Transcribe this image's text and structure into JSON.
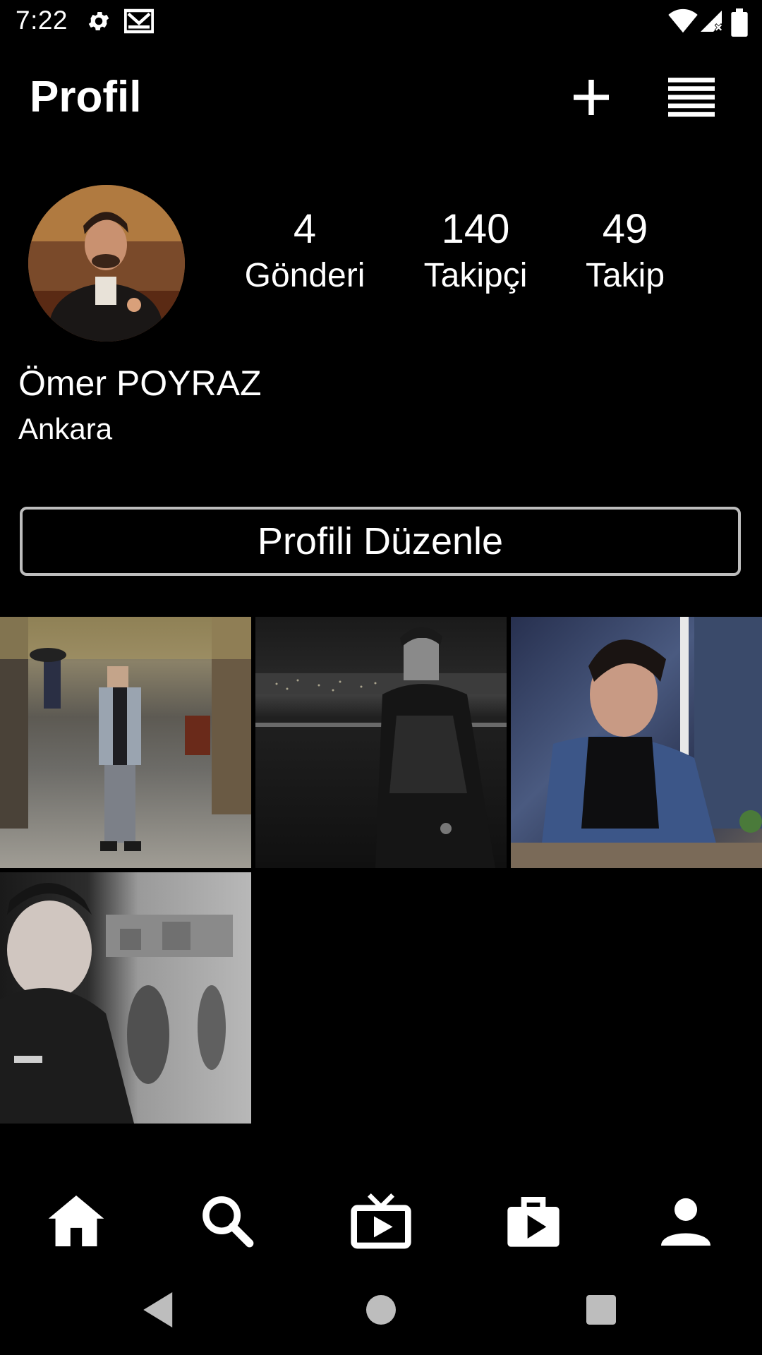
{
  "status_bar": {
    "time": "7:22"
  },
  "header": {
    "title": "Profil"
  },
  "profile": {
    "posts": {
      "count": "4",
      "label": "Gönderi"
    },
    "followers": {
      "count": "140",
      "label": "Takipçi"
    },
    "following": {
      "count": "49",
      "label": "Takip"
    },
    "name": "Ömer POYRAZ",
    "location": "Ankara",
    "edit_button": "Profili Düzenle"
  },
  "icons": {
    "status": [
      "gear-icon",
      "mail-icon",
      "wifi-icon",
      "signal-icon",
      "battery-icon"
    ],
    "header": [
      "plus-icon",
      "menu-icon"
    ],
    "bottom_nav": [
      "home-icon",
      "search-icon",
      "tv-icon",
      "shop-icon",
      "profile-icon"
    ],
    "system_nav": [
      "back-icon",
      "home-circle-icon",
      "recents-icon"
    ]
  },
  "posts": [
    {
      "alt": "post-1"
    },
    {
      "alt": "post-2"
    },
    {
      "alt": "post-3"
    },
    {
      "alt": "post-4"
    }
  ],
  "colors": {
    "background": "#000000",
    "text": "#ffffff",
    "border": "#bdbdbd"
  }
}
